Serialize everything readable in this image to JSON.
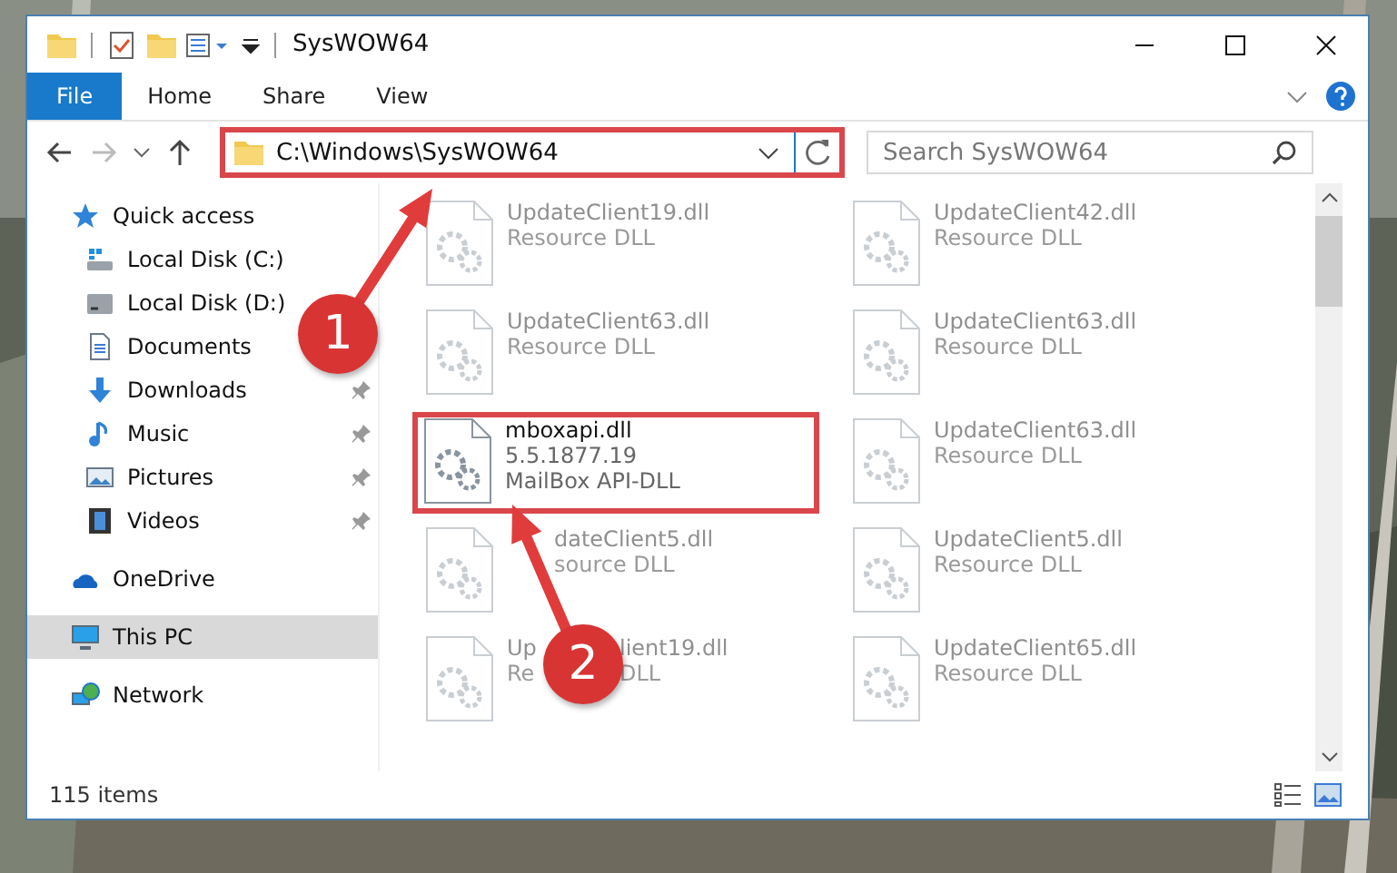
{
  "window": {
    "title": "SysWOW64"
  },
  "ribbon": {
    "tabs": [
      {
        "label": "File",
        "selected": true
      },
      {
        "label": "Home",
        "selected": false
      },
      {
        "label": "Share",
        "selected": false
      },
      {
        "label": "View",
        "selected": false
      }
    ]
  },
  "address": {
    "path": "C:\\Windows\\SysWOW64",
    "highlighted": true
  },
  "search": {
    "placeholder": "Search SysWOW64"
  },
  "sidebar": {
    "items": [
      {
        "label": "Quick access",
        "kind": "star",
        "selected": false,
        "children": [
          {
            "label": "Local Disk (C:)",
            "kind": "system-disk",
            "pinned": false,
            "selected": false
          },
          {
            "label": "Local Disk (D:)",
            "kind": "disk",
            "pinned": false,
            "selected": false
          },
          {
            "label": "Documents",
            "kind": "document",
            "pinned": false,
            "selected": false
          },
          {
            "label": "Downloads",
            "kind": "download",
            "pinned": true,
            "selected": false
          },
          {
            "label": "Music",
            "kind": "music",
            "pinned": true,
            "selected": false
          },
          {
            "label": "Pictures",
            "kind": "pictures",
            "pinned": true,
            "selected": false
          },
          {
            "label": "Videos",
            "kind": "videos",
            "pinned": true,
            "selected": false
          }
        ]
      },
      {
        "label": "OneDrive",
        "kind": "cloud",
        "selected": false
      },
      {
        "label": "This PC",
        "kind": "computer",
        "selected": true
      },
      {
        "label": "Network",
        "kind": "network",
        "selected": false
      }
    ]
  },
  "files": [
    {
      "name": "UpdateClient19.dll",
      "lines": [
        "Resource DLL"
      ],
      "faded": true,
      "highlighted": false
    },
    {
      "name": "UpdateClient63.dll",
      "lines": [
        "Resource DLL"
      ],
      "faded": true,
      "highlighted": false
    },
    {
      "name": "mboxapi.dll",
      "lines": [
        "5.5.1877.19",
        "MailBox API-DLL"
      ],
      "faded": false,
      "highlighted": true
    },
    {
      "name": "dateClient5.dll",
      "lines": [
        "source DLL"
      ],
      "faded": true,
      "highlighted": false
    },
    {
      "name": [
        "Up",
        "lient19.dll"
      ],
      "lines": [
        [
          "Re",
          "DLL"
        ]
      ],
      "faded": true,
      "highlighted": false
    },
    {
      "name": "UpdateClient42.dll",
      "lines": [
        "Resource DLL"
      ],
      "faded": true,
      "highlighted": false
    },
    {
      "name": "UpdateClient63.dll",
      "lines": [
        "Resource DLL"
      ],
      "faded": true,
      "highlighted": false
    },
    {
      "name": "UpdateClient63.dll",
      "lines": [
        "Resource DLL"
      ],
      "faded": true,
      "highlighted": false
    },
    {
      "name": "UpdateClient5.dll",
      "lines": [
        "Resource DLL"
      ],
      "faded": true,
      "highlighted": false
    },
    {
      "name": "UpdateClient65.dll",
      "lines": [
        "Resource DLL"
      ],
      "faded": true,
      "highlighted": false
    }
  ],
  "status_bar": {
    "count": "115 items"
  },
  "callouts": [
    {
      "number": "1"
    },
    {
      "number": "2"
    }
  ]
}
